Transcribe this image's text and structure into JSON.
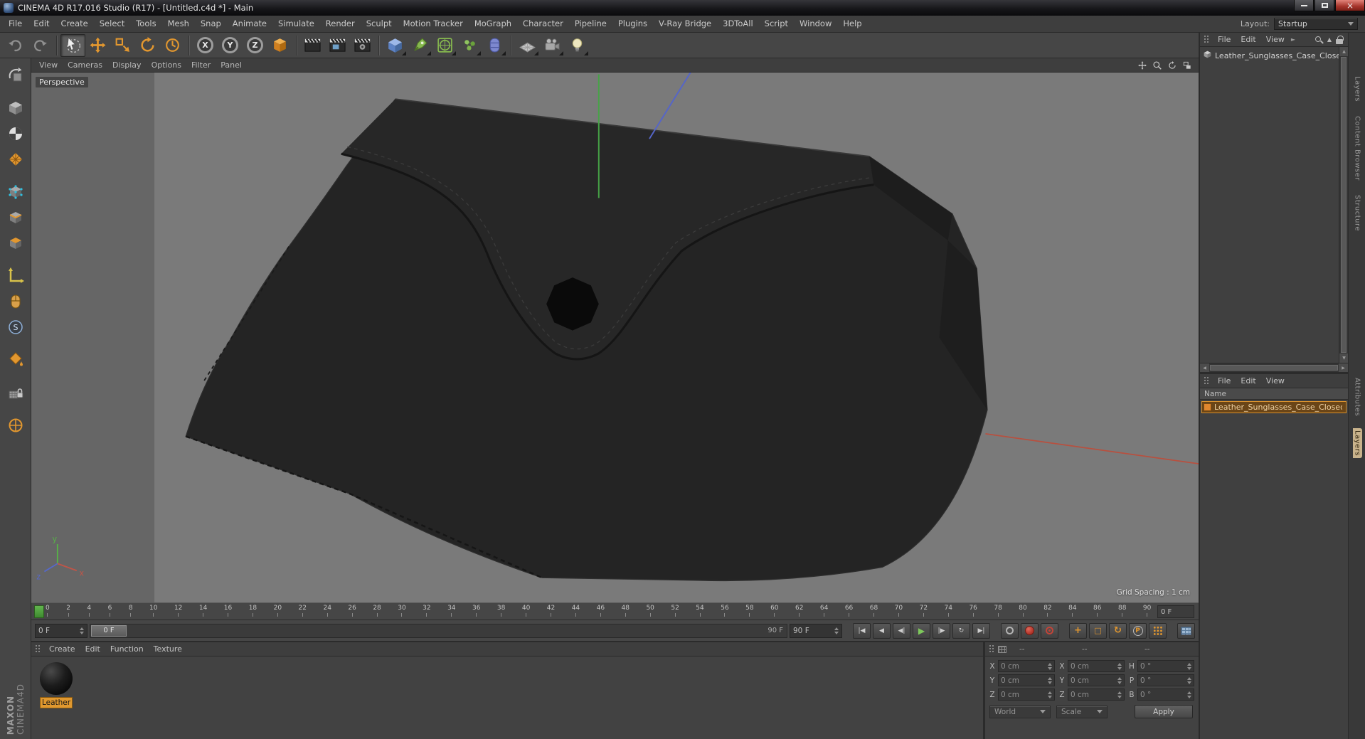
{
  "window": {
    "title": "CINEMA 4D R17.016 Studio (R17) - [Untitled.c4d *] - Main"
  },
  "menubar": {
    "items": [
      "File",
      "Edit",
      "Create",
      "Select",
      "Tools",
      "Mesh",
      "Snap",
      "Animate",
      "Simulate",
      "Render",
      "Sculpt",
      "Motion Tracker",
      "MoGraph",
      "Character",
      "Pipeline",
      "Plugins",
      "V-Ray Bridge",
      "3DToAll",
      "Script",
      "Window",
      "Help"
    ],
    "layout_label": "Layout:",
    "layout_value": "Startup"
  },
  "toolbar": {
    "icons": [
      {
        "name": "undo-icon",
        "type": "undo"
      },
      {
        "name": "redo-icon",
        "type": "redo"
      },
      {
        "type": "sep"
      },
      {
        "name": "live-selection-icon",
        "type": "cursor",
        "selected": true
      },
      {
        "name": "move-tool-icon",
        "type": "move"
      },
      {
        "name": "scale-tool-icon",
        "type": "scale"
      },
      {
        "name": "rotate-tool-icon",
        "type": "rotate"
      },
      {
        "name": "last-used-tool-icon",
        "type": "recent"
      },
      {
        "type": "sep"
      },
      {
        "name": "x-axis-lock-icon",
        "type": "axis",
        "letter": "X"
      },
      {
        "name": "y-axis-lock-icon",
        "type": "axis",
        "letter": "Y"
      },
      {
        "name": "z-axis-lock-icon",
        "type": "axis",
        "letter": "Z"
      },
      {
        "name": "coordinate-system-icon",
        "type": "coordsys"
      },
      {
        "type": "sep"
      },
      {
        "name": "render-view-icon",
        "type": "clapper"
      },
      {
        "name": "render-picture-viewer-icon",
        "type": "clapper2"
      },
      {
        "name": "render-settings-icon",
        "type": "clapper3"
      },
      {
        "type": "sep"
      },
      {
        "name": "add-cube-icon",
        "type": "cube",
        "submenu": true
      },
      {
        "name": "add-spline-icon",
        "type": "pen",
        "submenu": true
      },
      {
        "name": "add-generator-icon",
        "type": "subdiv",
        "submenu": true
      },
      {
        "name": "add-modeling-icon",
        "type": "atom",
        "submenu": true
      },
      {
        "name": "add-deformer-icon",
        "type": "deformer",
        "submenu": true
      },
      {
        "type": "sep"
      },
      {
        "name": "add-environment-icon",
        "type": "floor",
        "submenu": true
      },
      {
        "name": "add-camera-icon",
        "type": "camera",
        "submenu": true
      },
      {
        "name": "add-light-icon",
        "type": "light",
        "submenu": true
      }
    ]
  },
  "left_rail": {
    "icons": [
      {
        "name": "make-editable-icon",
        "type": "convert"
      },
      {
        "name": "model-mode-icon",
        "type": "model",
        "gap": true
      },
      {
        "name": "texture-mode-icon",
        "type": "texture"
      },
      {
        "name": "workplane-mode-icon",
        "type": "uvgrid"
      },
      {
        "name": "points-mode-icon",
        "type": "points",
        "gap": true
      },
      {
        "name": "edges-mode-icon",
        "type": "edges"
      },
      {
        "name": "polygons-mode-icon",
        "type": "polys"
      },
      {
        "name": "enable-axis-icon",
        "type": "axis",
        "gap": true
      },
      {
        "name": "tweak-mode-icon",
        "type": "mouse"
      },
      {
        "name": "snap-toggle-icon",
        "type": "snap"
      },
      {
        "name": "paint-workplane-icon",
        "type": "bucket",
        "gap": true
      },
      {
        "name": "lock-workplane-icon",
        "type": "lockgrid",
        "gap": true
      },
      {
        "name": "workplane-axis-icon",
        "type": "axiscircle",
        "gap": true
      }
    ]
  },
  "branding": {
    "line1": "MAXON",
    "line2": "CINEMA4D"
  },
  "viewport": {
    "menu": [
      "View",
      "Cameras",
      "Display",
      "Options",
      "Filter",
      "Panel"
    ],
    "camera_label": "Perspective",
    "grid_spacing_label": "Grid Spacing : 1 cm"
  },
  "timeline": {
    "tick_min": 0,
    "tick_max": 90,
    "tick_step": 2,
    "end_field": "0 F",
    "current_frame_field": "0 F",
    "slider_thumb_label": "0 F",
    "slider_max_label": "90 F",
    "max_frame_field": "90 F"
  },
  "transport": {
    "buttons": [
      {
        "name": "goto-start-button",
        "type": "goto_start"
      },
      {
        "name": "play-backwards-button",
        "type": "play_back"
      },
      {
        "name": "previous-frame-button",
        "type": "prev_frame"
      },
      {
        "name": "play-button",
        "type": "play"
      },
      {
        "name": "next-frame-button",
        "type": "next_frame"
      },
      {
        "name": "play-loop-button",
        "type": "loop"
      },
      {
        "name": "goto-end-button",
        "type": "goto_end"
      },
      {
        "type": "gap"
      },
      {
        "name": "record-keyframe-button",
        "type": "record"
      },
      {
        "name": "autokey-button",
        "type": "autokey"
      },
      {
        "name": "keyframe-selection-button",
        "type": "keysel"
      },
      {
        "type": "gap"
      },
      {
        "name": "record-position-toggle",
        "type": "rec_pos"
      },
      {
        "name": "record-scale-toggle",
        "type": "rec_scale"
      },
      {
        "name": "record-rotation-toggle",
        "type": "rec_rot"
      },
      {
        "name": "record-parameter-toggle",
        "type": "rec_param"
      },
      {
        "name": "record-pla-toggle",
        "type": "rec_pla"
      },
      {
        "type": "gap"
      },
      {
        "name": "keyframe-mode-button",
        "type": "keytable"
      }
    ]
  },
  "object_manager": {
    "menu": [
      "File",
      "Edit",
      "View"
    ],
    "objects": [
      {
        "name": "Leather_Sunglasses_Case_Closed_B"
      }
    ]
  },
  "layers_panel": {
    "menu": [
      "File",
      "Edit",
      "View"
    ],
    "name_header": "Name",
    "layers": [
      {
        "name": "Leather_Sunglasses_Case_Closed_",
        "color": "#e0872e",
        "selected": true
      }
    ]
  },
  "materials": {
    "menu": [
      "Create",
      "Edit",
      "Function",
      "Texture"
    ],
    "items": [
      {
        "name": "Leather"
      }
    ]
  },
  "coordinates": {
    "headers": [
      "--",
      "--",
      "--"
    ],
    "groups": [
      {
        "rows": [
          {
            "label": "X",
            "value": "0 cm"
          },
          {
            "label": "Y",
            "value": "0 cm"
          },
          {
            "label": "Z",
            "value": "0 cm"
          }
        ]
      },
      {
        "rows": [
          {
            "label": "X",
            "value": "0 cm"
          },
          {
            "label": "Y",
            "value": "0 cm"
          },
          {
            "label": "Z",
            "value": "0 cm"
          }
        ]
      },
      {
        "rows": [
          {
            "label": "H",
            "value": "0 °"
          },
          {
            "label": "P",
            "value": "0 °"
          },
          {
            "label": "B",
            "value": "0 °"
          }
        ]
      }
    ],
    "space_dropdown": "World",
    "mode_dropdown": "Scale",
    "apply_label": "Apply"
  },
  "right_tabs": {
    "top": [
      "Layers",
      "Content Browser",
      "Structure"
    ],
    "bottom": [
      {
        "label": "Attributes",
        "selected": false
      },
      {
        "label": "Layers",
        "selected": true
      }
    ]
  }
}
